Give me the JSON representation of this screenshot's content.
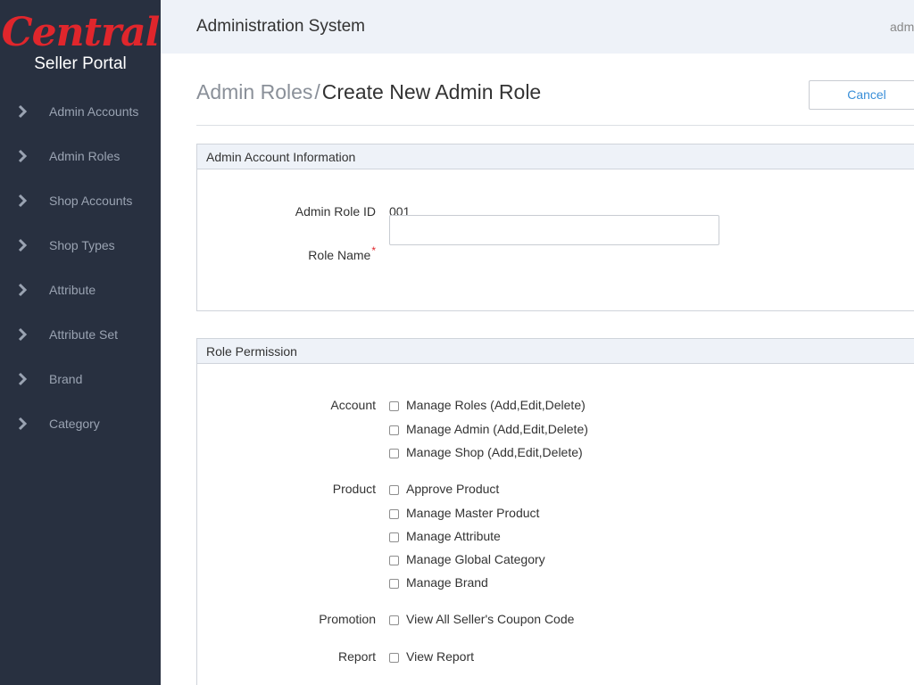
{
  "brand": {
    "logo_text": "Central",
    "portal_label": "Seller Portal"
  },
  "header": {
    "title": "Administration System",
    "user": "adm"
  },
  "sidebar": {
    "items": [
      {
        "label": "Admin Accounts"
      },
      {
        "label": "Admin Roles"
      },
      {
        "label": "Shop Accounts"
      },
      {
        "label": "Shop Types"
      },
      {
        "label": "Attribute"
      },
      {
        "label": "Attribute Set"
      },
      {
        "label": "Brand"
      },
      {
        "label": "Category"
      }
    ]
  },
  "breadcrumb": {
    "parent": "Admin Roles",
    "separator": "/",
    "current": "Create New Admin Role"
  },
  "actions": {
    "cancel_label": "Cancel"
  },
  "account_info": {
    "title": "Admin Account Information",
    "role_id_label": "Admin Role ID",
    "role_id_value": "001",
    "role_name_label": "Role Name",
    "required_mark": "*",
    "role_name_value": ""
  },
  "permissions": {
    "title": "Role Permission",
    "groups": [
      {
        "label": "Account",
        "options": [
          "Manage Roles (Add,Edit,Delete)",
          "Manage Admin (Add,Edit,Delete)",
          "Manage Shop (Add,Edit,Delete)"
        ]
      },
      {
        "label": "Product",
        "options": [
          "Approve Product",
          "Manage Master Product",
          "Manage Attribute",
          "Manage Global Category",
          "Manage Brand"
        ]
      },
      {
        "label": "Promotion",
        "options": [
          "View All Seller's Coupon Code"
        ]
      },
      {
        "label": "Report",
        "options": [
          "View Report"
        ]
      }
    ]
  },
  "colors": {
    "sidebar_bg": "#283040",
    "brand_red": "#e0262c",
    "link_blue": "#3a8fd8",
    "header_bg": "#eef2f8"
  }
}
